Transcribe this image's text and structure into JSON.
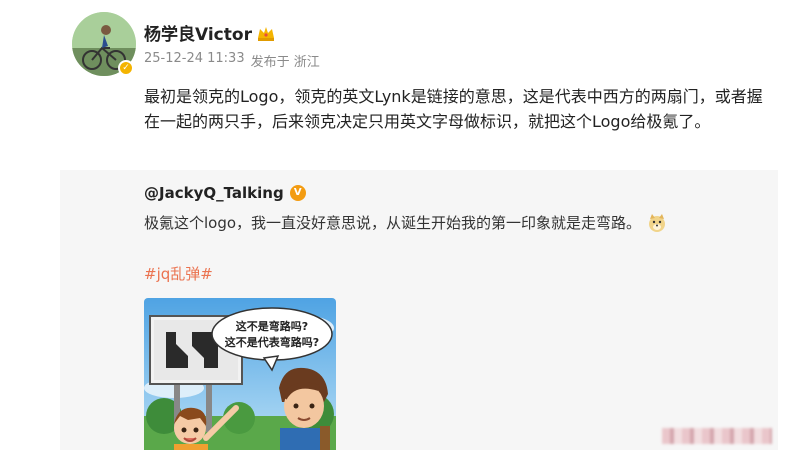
{
  "post": {
    "author": "杨学良Victor",
    "timestamp": "25-12-24 11:33",
    "source": "发布于 浙江",
    "text": "最初是领克的Logo，领克的英文Lynk是链接的意思，这是代表中西方的两扇门，或者握在一起的两只手，后来领克决定只用英文字母做标识，就把这个Logo给极氪了。"
  },
  "repost": {
    "author": "@JackyQ_Talking",
    "text": "极氪这个logo，我一直没好意思说，从诞生开始我的第一印象就是走弯路。",
    "hashtag": "#jq乱弹#",
    "image": {
      "bubble_line1": "这不是弯路吗?",
      "bubble_line2": "这不是代表弯路吗?"
    }
  },
  "colors": {
    "hashtag": "#eb7350",
    "card_bg": "#f6f6f6",
    "meta": "#8a8a8a"
  },
  "icons": [
    "crown-icon",
    "verified-badge-icon",
    "vip-icon",
    "doge-emoji-icon"
  ]
}
